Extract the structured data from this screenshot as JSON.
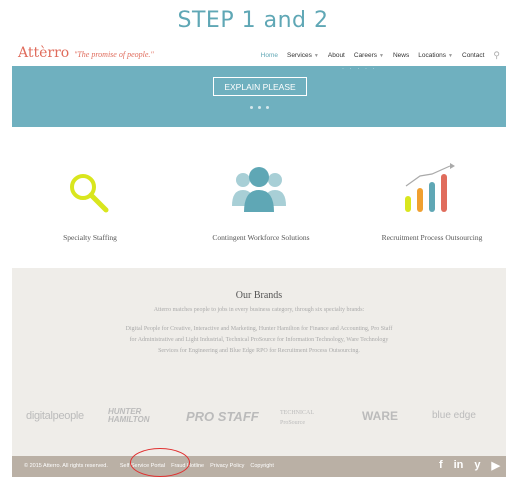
{
  "step_title": "STEP 1 and 2",
  "header": {
    "logo": "Attèrro",
    "tagline": "\"The promise of people.\"",
    "menu": [
      {
        "label": "Home",
        "active": true,
        "dropdown": false
      },
      {
        "label": "Services",
        "active": false,
        "dropdown": true
      },
      {
        "label": "About",
        "active": false,
        "dropdown": false
      },
      {
        "label": "Careers",
        "active": false,
        "dropdown": true
      },
      {
        "label": "News",
        "active": false,
        "dropdown": false
      },
      {
        "label": "Locations",
        "active": false,
        "dropdown": true
      },
      {
        "label": "Contact",
        "active": false,
        "dropdown": false
      }
    ]
  },
  "hero": {
    "button_label": "EXPLAIN PLEASE"
  },
  "services": [
    {
      "label": "Specialty Staffing",
      "icon": "magnifier-icon"
    },
    {
      "label": "Contingent Workforce Solutions",
      "icon": "people-group-icon"
    },
    {
      "label": "Recruitment Process Outsourcing",
      "icon": "bar-chart-growth-icon"
    }
  ],
  "brands": {
    "title": "Our Brands",
    "subtitle": "Atterro matches people to jobs in every business category, through six specialty brands:",
    "body": "Digital People for Creative, Interactive and Marketing, Hunter Hamilton for Finance and Accounting, Pro Staff for Administrative and Light Industrial, Technical ProSource for Information Technology, Ware Technology Services for Engineering and Blue Edge RPO for Recruitment Process Outsourcing.",
    "logos": [
      "digitalpeople",
      "HUNTER HAMILTON",
      "PRO STAFF",
      "TECHNICAL ProSource",
      "WARE",
      "blue edge"
    ]
  },
  "footer": {
    "copyright": "© 2015 Atterro. All rights reserved.",
    "links": [
      "Self Service Portal",
      "Fraud Hotline",
      "Privacy Policy",
      "Copyright"
    ],
    "social": [
      "f",
      "in",
      "y",
      "▶"
    ]
  },
  "colors": {
    "accent": "#5fa7b5",
    "logo": "#e06c5c",
    "hero": "#6fb0bf",
    "footer": "#bab0a5",
    "annotation": "#e03030"
  }
}
